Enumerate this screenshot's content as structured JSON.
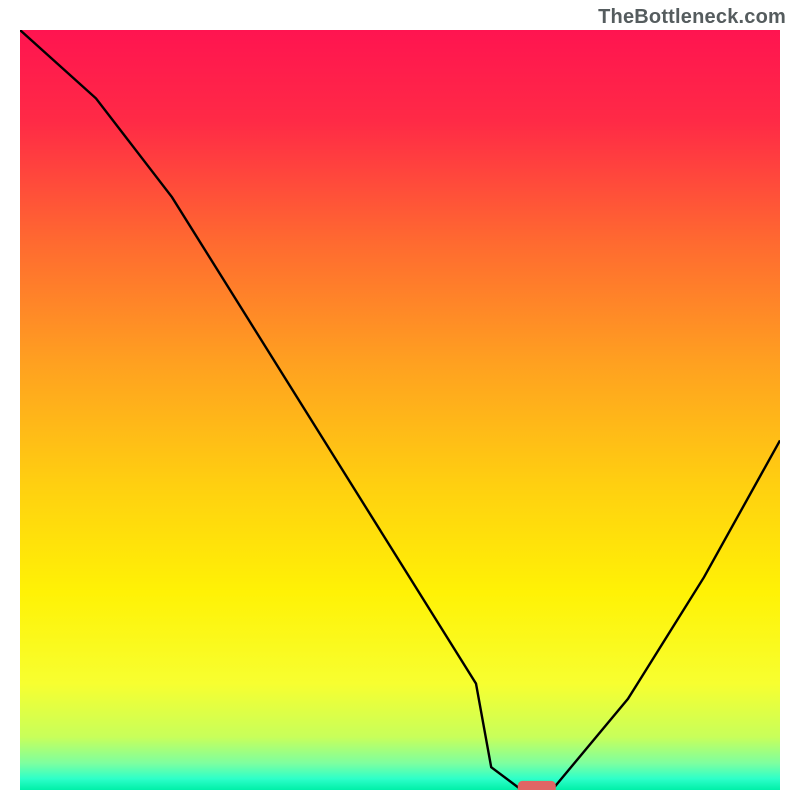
{
  "watermark": "TheBottleneck.com",
  "colors": {
    "gradient_stops": [
      {
        "offset": 0.0,
        "color": "#ff1450"
      },
      {
        "offset": 0.12,
        "color": "#ff2a46"
      },
      {
        "offset": 0.28,
        "color": "#ff6a30"
      },
      {
        "offset": 0.44,
        "color": "#ffa120"
      },
      {
        "offset": 0.6,
        "color": "#ffd010"
      },
      {
        "offset": 0.74,
        "color": "#fff205"
      },
      {
        "offset": 0.86,
        "color": "#f7ff30"
      },
      {
        "offset": 0.93,
        "color": "#c8ff5a"
      },
      {
        "offset": 0.965,
        "color": "#7dffa0"
      },
      {
        "offset": 0.985,
        "color": "#2effc9"
      },
      {
        "offset": 1.0,
        "color": "#00f0a8"
      }
    ],
    "curve": "#000000",
    "marker": "#e06565",
    "axis": "#000000"
  },
  "chart_data": {
    "type": "line",
    "title": "",
    "xlabel": "",
    "ylabel": "",
    "xlim": [
      0,
      100
    ],
    "ylim": [
      0,
      100
    ],
    "x": [
      0,
      10,
      20,
      30,
      40,
      50,
      60,
      62,
      66,
      70,
      80,
      90,
      100
    ],
    "values": [
      100,
      91,
      78,
      62,
      46,
      30,
      14,
      3,
      0,
      0,
      12,
      28,
      46
    ],
    "minimum_marker": {
      "x": 68,
      "y": 0,
      "width": 5,
      "height": 1.2
    }
  }
}
